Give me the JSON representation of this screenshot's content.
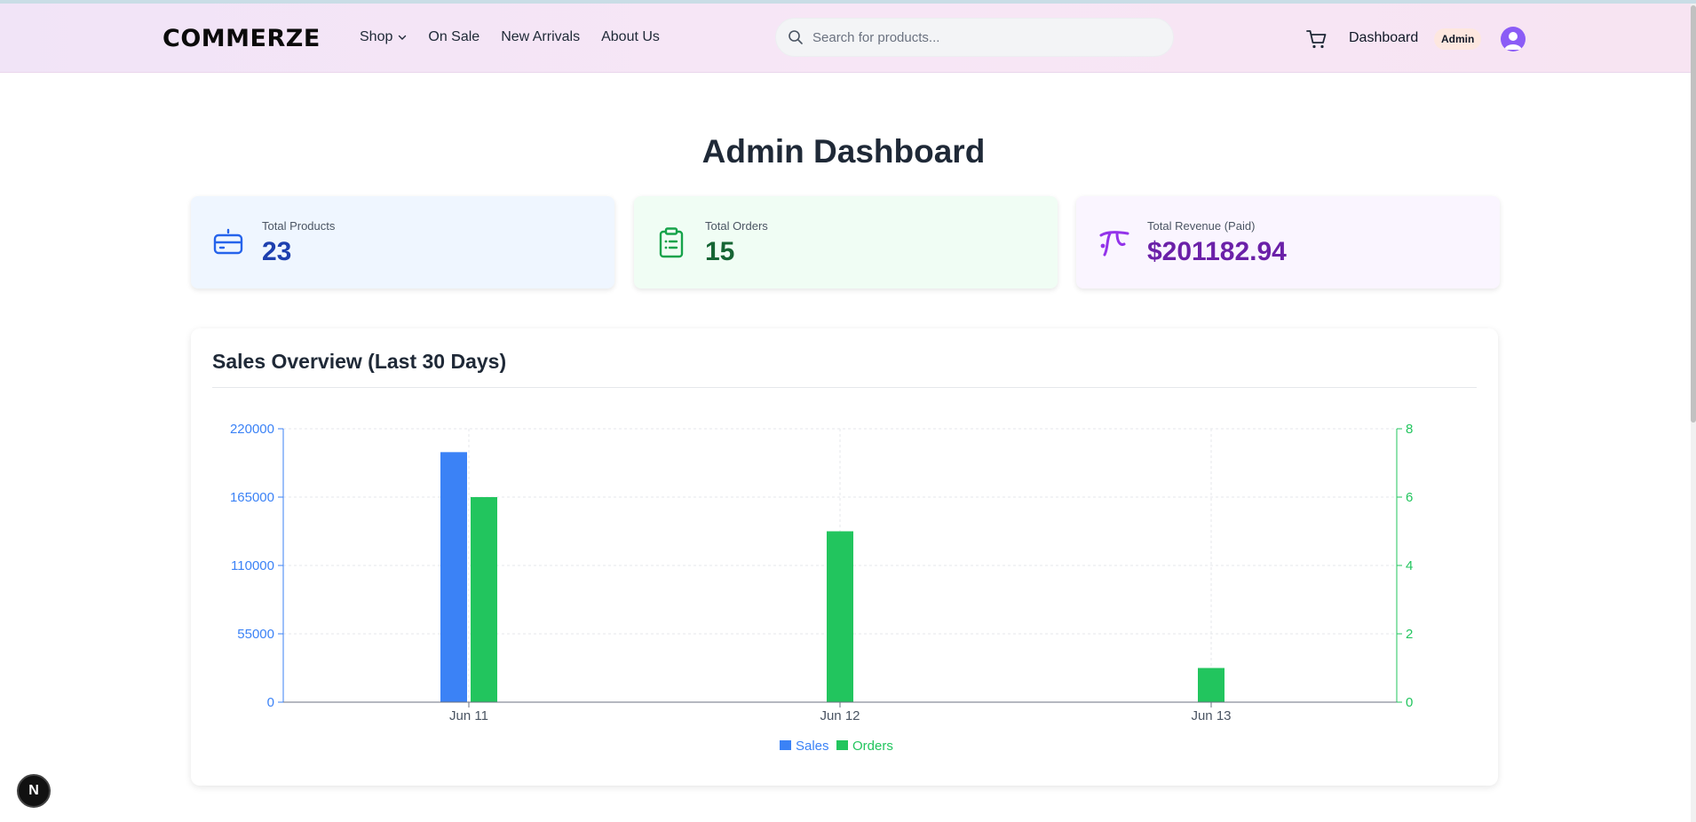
{
  "brand": {
    "logo": "COMMERZE"
  },
  "nav": {
    "links": [
      "Shop",
      "On Sale",
      "New Arrivals",
      "About Us"
    ],
    "search_placeholder": "Search for products...",
    "dashboard": "Dashboard",
    "role_badge": "Admin"
  },
  "page": {
    "title": "Admin Dashboard"
  },
  "stats": [
    {
      "label": "Total Products",
      "value": "23",
      "bg": "#eff6ff",
      "color": "#1e40af",
      "icon": "box-icon",
      "icon_color": "#2563eb"
    },
    {
      "label": "Total Orders",
      "value": "15",
      "bg": "#f0fdf4",
      "color": "#166534",
      "icon": "clipboard-list-icon",
      "icon_color": "#16a34a"
    },
    {
      "label": "Total Revenue (Paid)",
      "value": "$201182.94",
      "bg": "#faf5ff",
      "color": "#6b21a8",
      "icon": "revenue-icon",
      "icon_color": "#9333ea"
    }
  ],
  "sales_card": {
    "title": "Sales Overview (Last 30 Days)"
  },
  "chart_data": {
    "type": "bar",
    "categories": [
      "Jun 11",
      "Jun 12",
      "Jun 13"
    ],
    "series": [
      {
        "name": "Sales",
        "axis": "left",
        "color": "#3b82f6",
        "values": [
          201182.94,
          0,
          0
        ]
      },
      {
        "name": "Orders",
        "axis": "right",
        "color": "#22c55e",
        "values": [
          6,
          5,
          1
        ]
      }
    ],
    "y_left": {
      "ticks": [
        0,
        55000,
        110000,
        165000,
        220000
      ],
      "range": [
        0,
        220000
      ],
      "color": "#3b82f6"
    },
    "y_right": {
      "ticks": [
        0,
        2,
        4,
        6,
        8
      ],
      "range": [
        0,
        8
      ],
      "color": "#22c55e"
    },
    "grid": true,
    "legend": "bottom-center"
  },
  "dev_badge": "N"
}
